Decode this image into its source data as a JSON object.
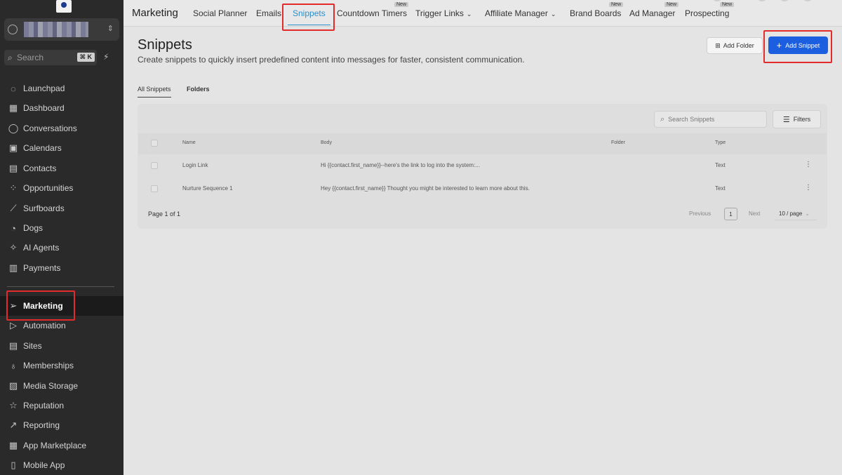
{
  "sidebar": {
    "search_placeholder": "Search",
    "search_shortcut": "⌘ K",
    "items": [
      {
        "label": "Launchpad",
        "icon": "rocket-icon",
        "glyph": "◌"
      },
      {
        "label": "Dashboard",
        "icon": "dashboard-icon",
        "glyph": "▦"
      },
      {
        "label": "Conversations",
        "icon": "chat-icon",
        "glyph": "◯"
      },
      {
        "label": "Calendars",
        "icon": "calendar-icon",
        "glyph": "▣"
      },
      {
        "label": "Contacts",
        "icon": "contacts-icon",
        "glyph": "▤"
      },
      {
        "label": "Opportunities",
        "icon": "opportunities-icon",
        "glyph": "⁘"
      },
      {
        "label": "Surfboards",
        "icon": "surfboard-icon",
        "glyph": "⟋"
      },
      {
        "label": "Dogs",
        "icon": "dog-icon",
        "glyph": "◔"
      },
      {
        "label": "AI Agents",
        "icon": "sparkle-icon",
        "glyph": "✧"
      },
      {
        "label": "Payments",
        "icon": "payments-icon",
        "glyph": "▥"
      },
      {
        "label": "Marketing",
        "icon": "send-icon",
        "glyph": "➢"
      },
      {
        "label": "Automation",
        "icon": "automation-icon",
        "glyph": "▷"
      },
      {
        "label": "Sites",
        "icon": "sites-icon",
        "glyph": "▤"
      },
      {
        "label": "Memberships",
        "icon": "membership-icon",
        "glyph": "♁"
      },
      {
        "label": "Media Storage",
        "icon": "media-icon",
        "glyph": "▨"
      },
      {
        "label": "Reputation",
        "icon": "star-icon",
        "glyph": "☆"
      },
      {
        "label": "Reporting",
        "icon": "chart-line-icon",
        "glyph": "↗"
      },
      {
        "label": "App Marketplace",
        "icon": "apps-icon",
        "glyph": "▦"
      },
      {
        "label": "Mobile App",
        "icon": "mobile-icon",
        "glyph": "▯"
      }
    ],
    "active": "Marketing"
  },
  "topbar": {
    "brand": "Marketing",
    "tabs": [
      {
        "label": "Social Planner",
        "badge": ""
      },
      {
        "label": "Emails",
        "badge": ""
      },
      {
        "label": "Snippets",
        "badge": ""
      },
      {
        "label": "Countdown Timers",
        "badge": "New"
      },
      {
        "label": "Trigger Links",
        "badge": ""
      },
      {
        "label": "Affiliate Manager",
        "badge": ""
      },
      {
        "label": "Brand Boards",
        "badge": "New"
      },
      {
        "label": "Ad Manager",
        "badge": "New"
      },
      {
        "label": "Prospecting",
        "badge": "New"
      }
    ]
  },
  "page": {
    "title": "Snippets",
    "subtitle": "Create snippets to quickly insert predefined content into messages for faster, consistent communication.",
    "add_folder_label": "Add Folder",
    "add_snippet_label": "Add Snippet",
    "subtabs": [
      "All Snippets",
      "Folders"
    ]
  },
  "table": {
    "search_placeholder": "Search Snippets",
    "filters_label": "Filters",
    "columns": [
      "Name",
      "Body",
      "Folder",
      "Type"
    ],
    "rows": [
      {
        "name": "Login Link",
        "body": "Hi {{contact.first_name}}--here's the link to log into the system:...",
        "folder": "",
        "type": "Text"
      },
      {
        "name": "Nurture Sequence 1",
        "body": "Hey {{contact.first_name}} Thought you might be interested to learn more about this.",
        "folder": "",
        "type": "Text"
      }
    ],
    "pagination": {
      "page_text": "Page 1 of 1",
      "previous": "Previous",
      "current": "1",
      "next": "Next",
      "page_size": "10 / page"
    }
  },
  "colors": {
    "accent": "#2d8ec9",
    "primary_button": "#1b5fe0",
    "highlight": "#e32b2b",
    "sidebar_bg": "#2a2a2a"
  }
}
